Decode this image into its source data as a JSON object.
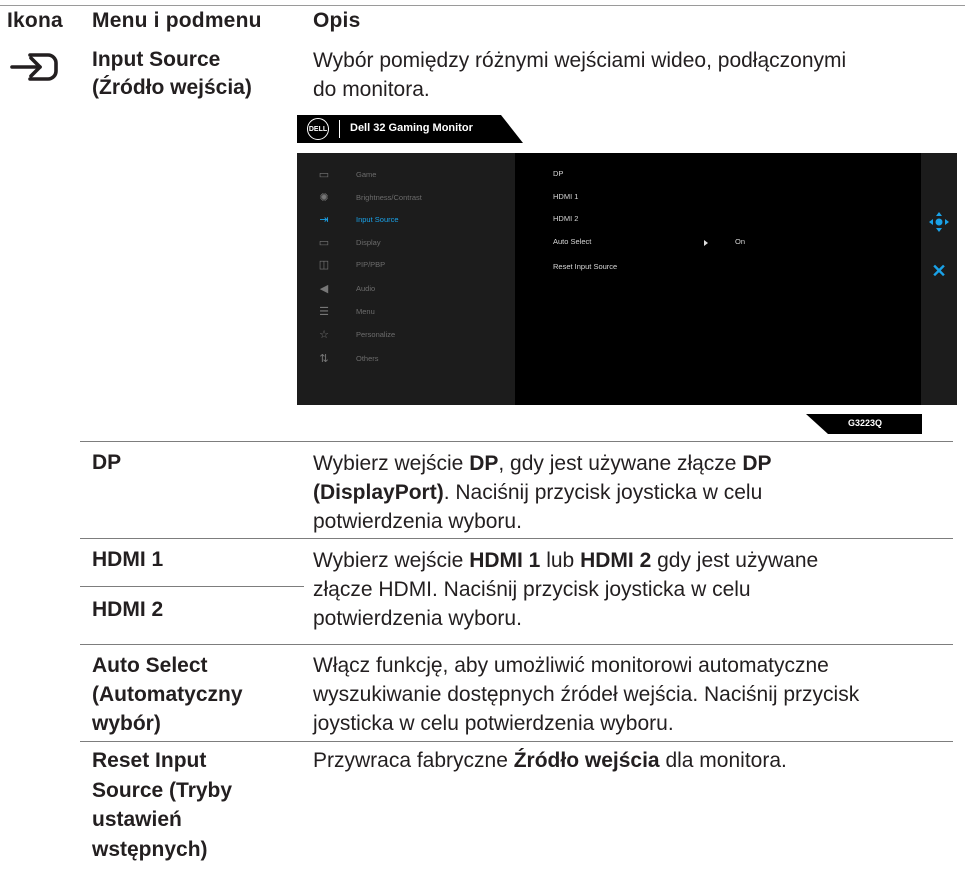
{
  "headers": {
    "icon": "Ikona",
    "menu": "Menu i podmenu",
    "desc": "Opis"
  },
  "input_source": {
    "icon": "input-source-icon",
    "name_line1": "Input Source",
    "name_line2": "(Źródło wejścia)",
    "desc_line1": "Wybór pomiędzy różnymi wejściami wideo, podłączonymi",
    "desc_line2": "do monitora."
  },
  "osd": {
    "brand": "DELL",
    "title": "Dell 32 Gaming Monitor",
    "menu": [
      {
        "label": "Game",
        "icon": "game-icon",
        "glyph": "▭"
      },
      {
        "label": "Brightness/Contrast",
        "icon": "brightness-icon",
        "glyph": "✺"
      },
      {
        "label": "Input Source",
        "icon": "input-icon",
        "glyph": "⇥"
      },
      {
        "label": "Display",
        "icon": "display-icon",
        "glyph": "▭"
      },
      {
        "label": "PIP/PBP",
        "icon": "pip-icon",
        "glyph": "◫"
      },
      {
        "label": "Audio",
        "icon": "audio-icon",
        "glyph": "◀"
      },
      {
        "label": "Menu",
        "icon": "menu-icon",
        "glyph": "☰"
      },
      {
        "label": "Personalize",
        "icon": "star-icon",
        "glyph": "☆"
      },
      {
        "label": "Others",
        "icon": "others-icon",
        "glyph": "⇅"
      }
    ],
    "active_index": 2,
    "sub": [
      "DP",
      "HDMI 1",
      "HDMI 2",
      "Auto Select",
      "Reset Input Source"
    ],
    "auto_select_value": "On",
    "model": "G3223Q",
    "accent": "#1aa2e8"
  },
  "rows": {
    "dp": {
      "name": "DP",
      "d1a": "Wybierz wejście ",
      "d1b": "DP",
      "d1c": ", gdy jest używane złącze ",
      "d1d": "DP",
      "d2": "(DisplayPort)",
      "d2b": ". Naciśnij przycisk joysticka w celu",
      "d3": "potwierdzenia wyboru."
    },
    "hdmi": {
      "name1": "HDMI 1",
      "name2": "HDMI 2",
      "d1a": "Wybierz wejście ",
      "d1b": "HDMI 1",
      "d1c": " lub ",
      "d1d": "HDMI 2",
      "d1e": " gdy jest używane",
      "d2": "złącze HDMI. Naciśnij przycisk joysticka w celu",
      "d3": "potwierdzenia wyboru."
    },
    "auto": {
      "name1": "Auto Select",
      "name2": "(Automatyczny",
      "name3": "wybór)",
      "d1": "Włącz funkcję, aby umożliwić monitorowi automatyczne",
      "d2": "wyszukiwanie dostępnych źródeł wejścia. Naciśnij przycisk",
      "d3": "joysticka w celu potwierdzenia wyboru."
    },
    "reset": {
      "name1": "Reset Input",
      "name2": "Source (Tryby",
      "name3": "ustawień",
      "name4": "wstępnych)",
      "d1a": "Przywraca fabryczne ",
      "d1b": "Źródło wejścia",
      "d1c": " dla monitora."
    }
  }
}
